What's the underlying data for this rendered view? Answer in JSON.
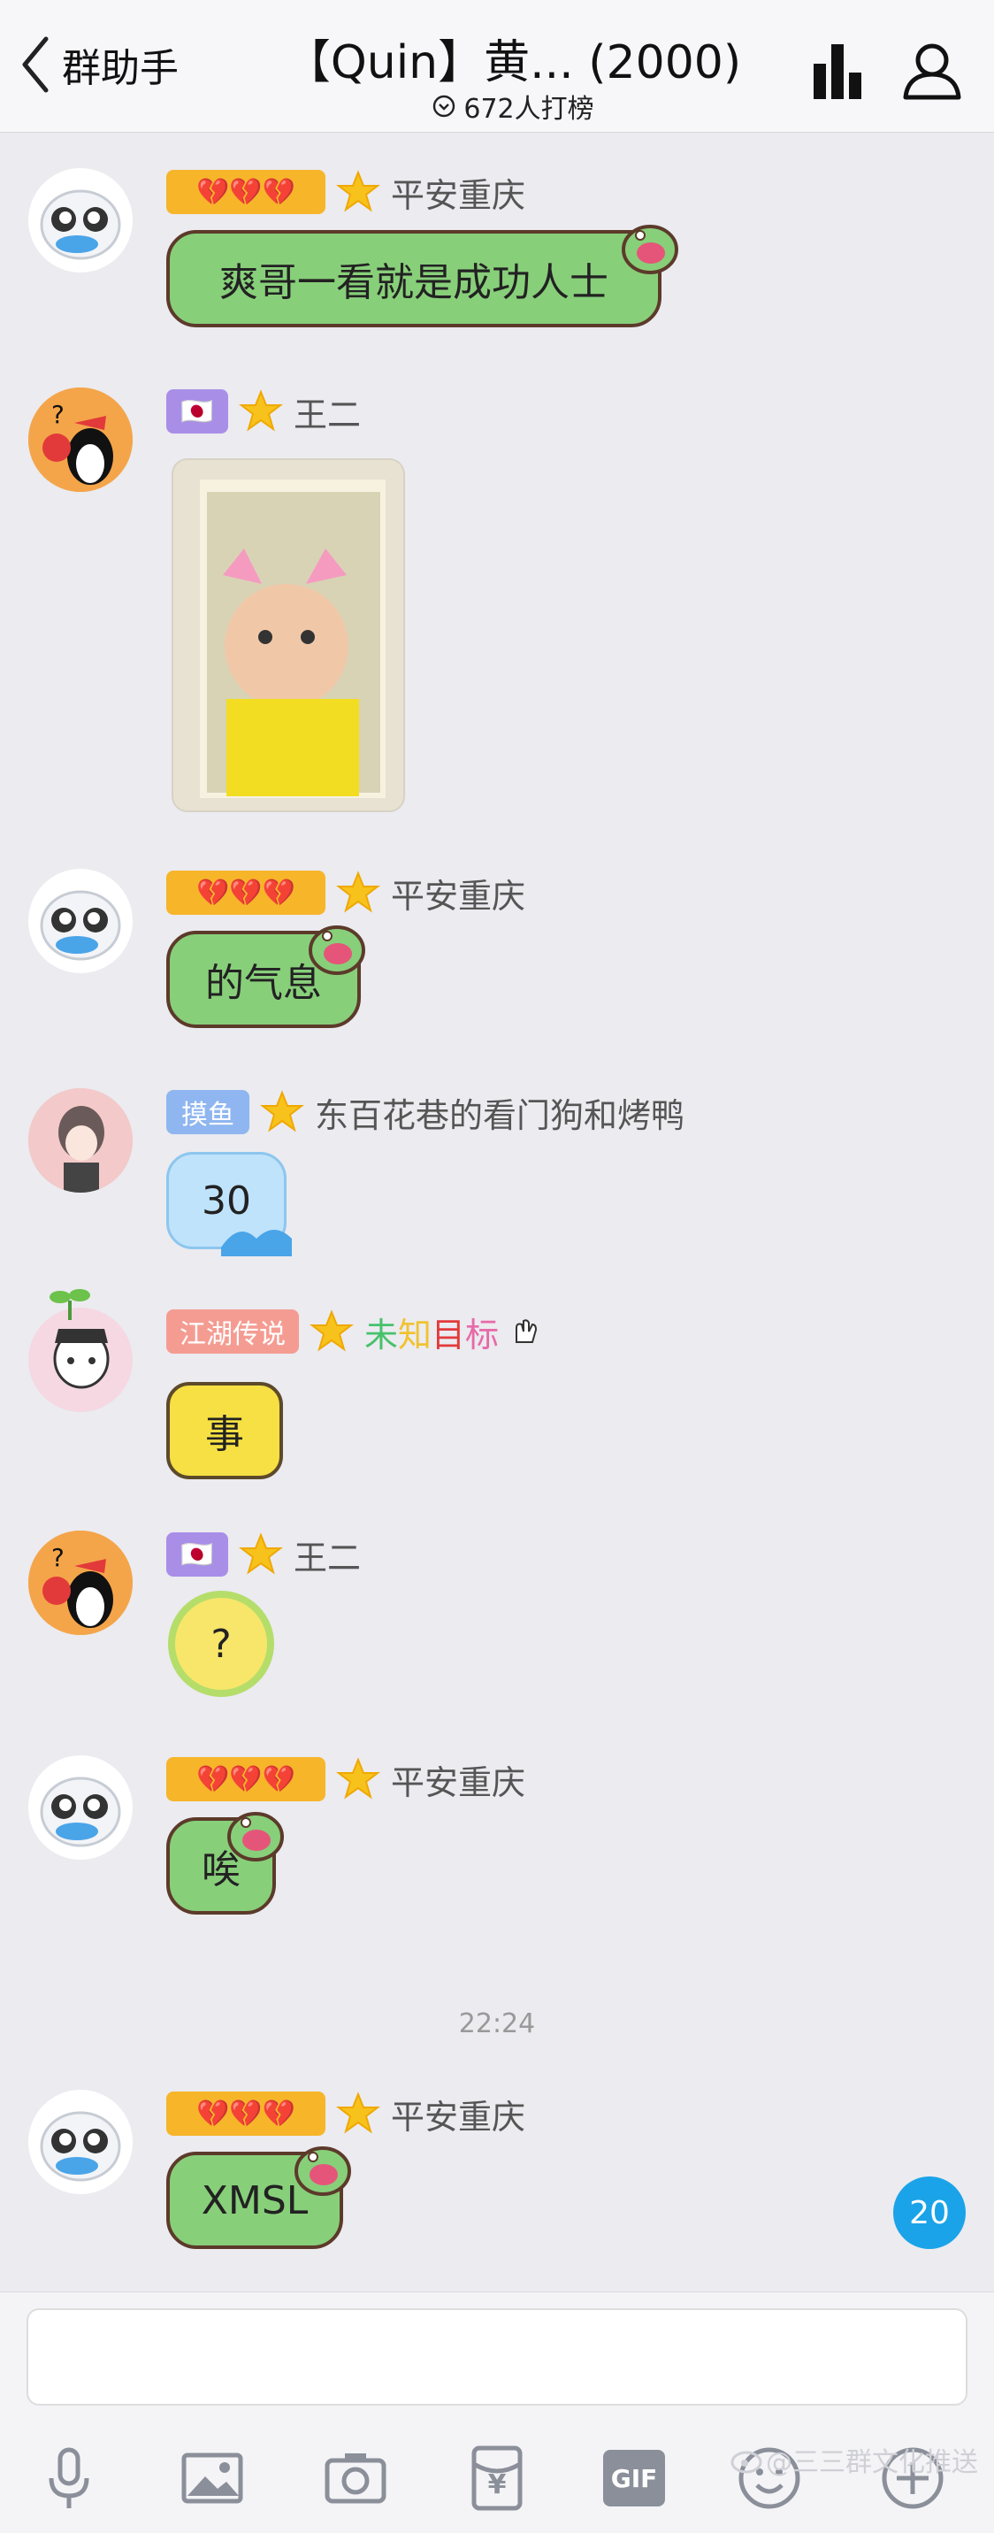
{
  "header": {
    "back_label": "群助手",
    "title": "【Quin】黄... (2000)",
    "subtitle": "672人打榜"
  },
  "messages": [
    {
      "badge": "💔💔💔",
      "name": "平安重庆",
      "text": "爽哥一看就是成功人士"
    },
    {
      "badge": "🇯🇵",
      "name": "王二",
      "image_desc": "photo"
    },
    {
      "badge": "💔💔💔",
      "name": "平安重庆",
      "text": "的气息"
    },
    {
      "badge": "摸鱼",
      "name": "东百花巷的看门狗和烤鸭",
      "text": "30"
    },
    {
      "badge": "江湖传说",
      "name_parts": [
        "未",
        "知",
        "目",
        "标"
      ],
      "text": "事"
    },
    {
      "badge": "🇯🇵",
      "name": "王二",
      "text": "?"
    },
    {
      "badge": "💔💔💔",
      "name": "平安重庆",
      "text": "唉"
    },
    {
      "badge": "💔💔💔",
      "name": "平安重庆",
      "text": "XMSL"
    }
  ],
  "timestamp": "22:24",
  "unread_count": "20",
  "toolbar": {
    "icons": [
      "microphone-icon",
      "image-icon",
      "camera-icon",
      "red-packet-icon",
      "gif-icon",
      "emoji-icon",
      "plus-icon"
    ],
    "gif_label": "GIF",
    "yen_label": "¥"
  },
  "watermark": "@三三群文化推送",
  "colors": {
    "accent": "#1aa3e8",
    "bubble_green": "#88cf7a",
    "badge_orange": "#f7b52a",
    "badge_purple": "#a98ee8",
    "badge_blue": "#8fb6f0",
    "badge_salmon": "#f59c92",
    "name_green": "#47c26b",
    "name_yellow": "#f1c232",
    "name_red": "#e33a3a",
    "name_pink": "#e86aa8"
  }
}
